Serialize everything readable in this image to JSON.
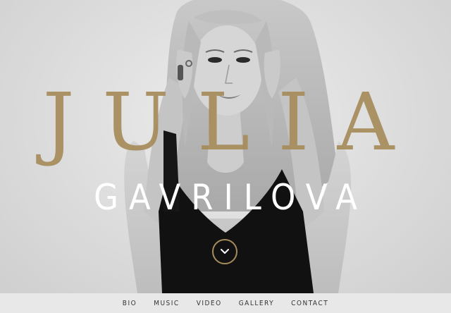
{
  "hero": {
    "first_name": "JULIA",
    "last_name": "GAVRILOVA",
    "accent_color": "#a68c5b",
    "photo": "black-and-white portrait"
  },
  "scroll_button": {
    "icon": "chevron-down-icon"
  },
  "nav": {
    "items": [
      {
        "label": "BIO"
      },
      {
        "label": "MUSIC"
      },
      {
        "label": "VIDEO"
      },
      {
        "label": "GALLERY"
      },
      {
        "label": "CONTACT"
      }
    ]
  }
}
